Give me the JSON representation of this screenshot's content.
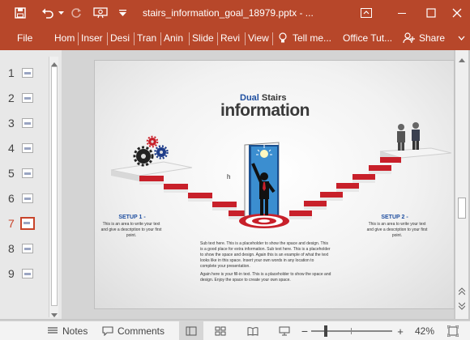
{
  "window": {
    "title": "stairs_information_goal_18979.pptx - ...",
    "colors": {
      "accent": "#b7472a",
      "selected": "#c8442a"
    }
  },
  "ribbon": {
    "file": "File",
    "tabs": [
      "Hom",
      "Inser",
      "Desi",
      "Tran",
      "Anin",
      "Slide",
      "Revi",
      "View"
    ],
    "tell_me": "Tell me...",
    "office_tut": "Office Tut...",
    "share": "Share"
  },
  "thumbnails": [
    {
      "number": "1"
    },
    {
      "number": "2"
    },
    {
      "number": "3"
    },
    {
      "number": "4"
    },
    {
      "number": "5"
    },
    {
      "number": "6"
    },
    {
      "number": "7"
    },
    {
      "number": "8"
    },
    {
      "number": "9"
    }
  ],
  "selected_slide": "7",
  "slide": {
    "title_line1_a": "Dual",
    "title_line1_b": "Stairs",
    "title_line2": "information",
    "left_heading": "SETUP 1 -",
    "left_body": "This is an area to write your text and give a description to your first point.",
    "right_heading": "SETUP 2 -",
    "right_body": "This is an area to write your text and give a description to your first point.",
    "center_para1": "Sub text here. This is a placeholder to show the space and design. This is a good place for extra information. Sub text here. This is a placeholder to show the space and design. Again this is an example of what the text looks like in this space. Insert your own words in any location to complete your presentation.",
    "center_para2": "Again here is your fill-in text. This is a placeholder to show the space and design. Enjoy the space to create your own space."
  },
  "status": {
    "notes": "Notes",
    "comments": "Comments",
    "zoom": "42%",
    "zoom_level": 0.42
  }
}
